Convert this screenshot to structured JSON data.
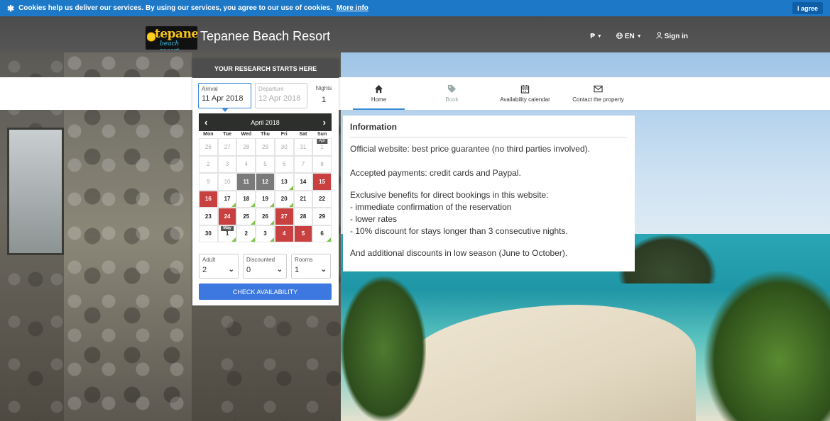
{
  "cookie": {
    "message": "Cookies help us deliver our services. By using our services, you agree to our use of cookies.",
    "more_info": "More info",
    "agree": "I agree"
  },
  "header": {
    "logo_word": "tepanee",
    "logo_sub": "beach resort",
    "title": "Tepanee Beach Resort",
    "currency": "₱",
    "language": "EN",
    "sign_in": "Sign in"
  },
  "nav": {
    "tabs": [
      {
        "label": "Home",
        "icon": "home-icon"
      },
      {
        "label": "Book",
        "icon": "tags-icon"
      },
      {
        "label": "Availability calendar",
        "icon": "calendar-icon"
      },
      {
        "label": "Contact the property",
        "icon": "envelope-icon"
      }
    ]
  },
  "search": {
    "heading": "YOUR RESEARCH STARTS HERE",
    "arrival_label": "Arrival",
    "arrival_value": "11 Apr 2018",
    "departure_label": "Departure",
    "departure_placeholder": "12 Apr 2018",
    "nights_label": "Nights",
    "nights_value": "1",
    "calendar": {
      "month": "April 2018",
      "weekdays": [
        "Mon",
        "Tue",
        "Wed",
        "Thu",
        "Fri",
        "Sat",
        "Sun"
      ],
      "days": [
        {
          "d": "26",
          "s": "other"
        },
        {
          "d": "27",
          "s": "other"
        },
        {
          "d": "28",
          "s": "other"
        },
        {
          "d": "29",
          "s": "other"
        },
        {
          "d": "30",
          "s": "other"
        },
        {
          "d": "31",
          "s": "other"
        },
        {
          "d": "1",
          "s": "past",
          "tag": "Apr"
        },
        {
          "d": "2",
          "s": "past"
        },
        {
          "d": "3",
          "s": "past"
        },
        {
          "d": "4",
          "s": "past"
        },
        {
          "d": "5",
          "s": "past"
        },
        {
          "d": "6",
          "s": "past"
        },
        {
          "d": "7",
          "s": "past"
        },
        {
          "d": "8",
          "s": "past"
        },
        {
          "d": "9",
          "s": "past"
        },
        {
          "d": "10",
          "s": "past"
        },
        {
          "d": "11",
          "s": "selected"
        },
        {
          "d": "12",
          "s": "selected"
        },
        {
          "d": "13",
          "s": "avail"
        },
        {
          "d": "14",
          "s": "avail"
        },
        {
          "d": "15",
          "s": "booked"
        },
        {
          "d": "16",
          "s": "booked"
        },
        {
          "d": "17",
          "s": "avail"
        },
        {
          "d": "18",
          "s": "avail"
        },
        {
          "d": "19",
          "s": "avail"
        },
        {
          "d": "20",
          "s": "avail"
        },
        {
          "d": "21",
          "s": "avail"
        },
        {
          "d": "22",
          "s": "avail"
        },
        {
          "d": "23",
          "s": "avail"
        },
        {
          "d": "24",
          "s": "booked"
        },
        {
          "d": "25",
          "s": "avail"
        },
        {
          "d": "26",
          "s": "avail"
        },
        {
          "d": "27",
          "s": "booked"
        },
        {
          "d": "28",
          "s": "avail"
        },
        {
          "d": "29",
          "s": "avail"
        },
        {
          "d": "30",
          "s": "avail"
        },
        {
          "d": "1",
          "s": "avail",
          "tag": "May"
        },
        {
          "d": "2",
          "s": "avail"
        },
        {
          "d": "3",
          "s": "avail"
        },
        {
          "d": "4",
          "s": "booked"
        },
        {
          "d": "5",
          "s": "booked"
        },
        {
          "d": "6",
          "s": "avail"
        }
      ]
    },
    "adult_label": "Adult",
    "adult_value": "2",
    "discounted_label": "Discounted",
    "discounted_value": "0",
    "rooms_label": "Rooms",
    "rooms_value": "1",
    "check_button": "CHECK AVAILABILITY"
  },
  "info": {
    "title": "Information",
    "p1": "Official website: best price guarantee (no third parties involved).",
    "p2": "Accepted payments: credit cards and Paypal.",
    "p3_lines": [
      "Exclusive benefits for direct bookings in this website:",
      "- immediate confirmation of the reservation",
      "- lower rates",
      "- 10% discount for stays longer than 3 consecutive nights."
    ],
    "p4": "And additional discounts in low season (June to October)."
  },
  "colors": {
    "cookie_bar": "#1e78c8",
    "booked": "#c84040",
    "selected": "#7a7a7a",
    "available_marker": "#7ec24a",
    "button": "#3d78e0"
  }
}
